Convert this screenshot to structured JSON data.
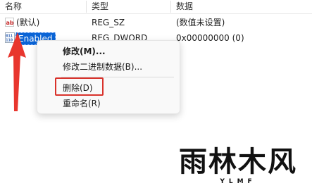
{
  "columns": {
    "name": "名称",
    "type": "类型",
    "data": "数据"
  },
  "rows": [
    {
      "icon": "string-value-icon",
      "name": "(默认)",
      "type": "REG_SZ",
      "data": "(数值未设置)"
    },
    {
      "icon": "binary-value-icon",
      "name": "Enabled",
      "type": "REG_DWORD",
      "data": "0x00000000 (0)",
      "selected": true
    }
  ],
  "context_menu": {
    "items": [
      {
        "label": "修改(M)...",
        "bold": true
      },
      {
        "label": "修改二进制数据(B)..."
      },
      {
        "label": "删除(D)",
        "highlighted": true
      },
      {
        "label": "重命名(R)"
      }
    ]
  },
  "annotation": {
    "arrow_color": "#e8362e",
    "highlight_color": "#d9322b"
  },
  "watermark": {
    "brand": "雨林木风",
    "sub": "YLMF"
  },
  "colors": {
    "selection": "#0a64d6",
    "menu_bg": "#f9f9f9"
  }
}
